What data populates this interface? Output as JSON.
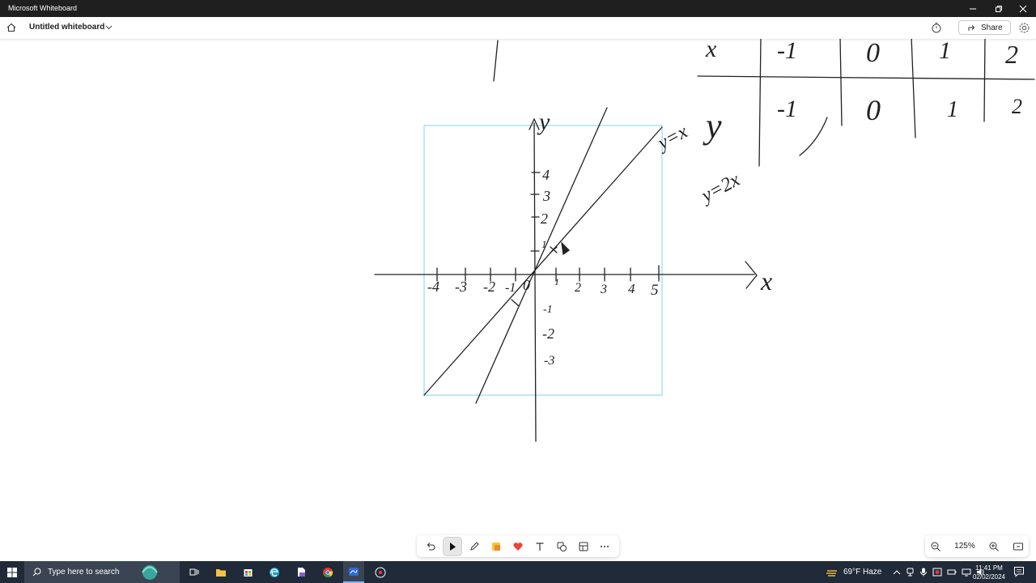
{
  "window": {
    "title": "Microsoft Whiteboard"
  },
  "header": {
    "board_title": "Untitled whiteboard",
    "share_label": "Share"
  },
  "canvas": {
    "axis_labels": {
      "x": "x",
      "y": "y"
    },
    "x_ticks": [
      "-4",
      "-3",
      "-2",
      "-1",
      "0",
      "1",
      "2",
      "3",
      "4",
      "5"
    ],
    "y_ticks": [
      "4",
      "3",
      "2",
      "1",
      "-1",
      "-2",
      "-3"
    ],
    "line_labels": [
      "y=x",
      "y=2x"
    ],
    "table": {
      "row_x": [
        "x",
        "-1",
        "0",
        "1",
        "2"
      ],
      "row_y": [
        "y",
        "-1",
        "0",
        "1",
        "2"
      ]
    },
    "ink_color": "#222222",
    "frame_color": "#7fd3e6"
  },
  "toolbar": {
    "tools": [
      "undo-icon",
      "select-icon",
      "pen-icon",
      "sticky-note-icon",
      "reaction-icon",
      "text-icon",
      "shapes-icon",
      "templates-icon",
      "more-icon"
    ]
  },
  "zoom": {
    "level": "125%"
  },
  "taskbar": {
    "search_placeholder": "Type here to search",
    "weather": "69°F  Haze",
    "time": "11:41 PM",
    "date": "02/02/2024"
  }
}
